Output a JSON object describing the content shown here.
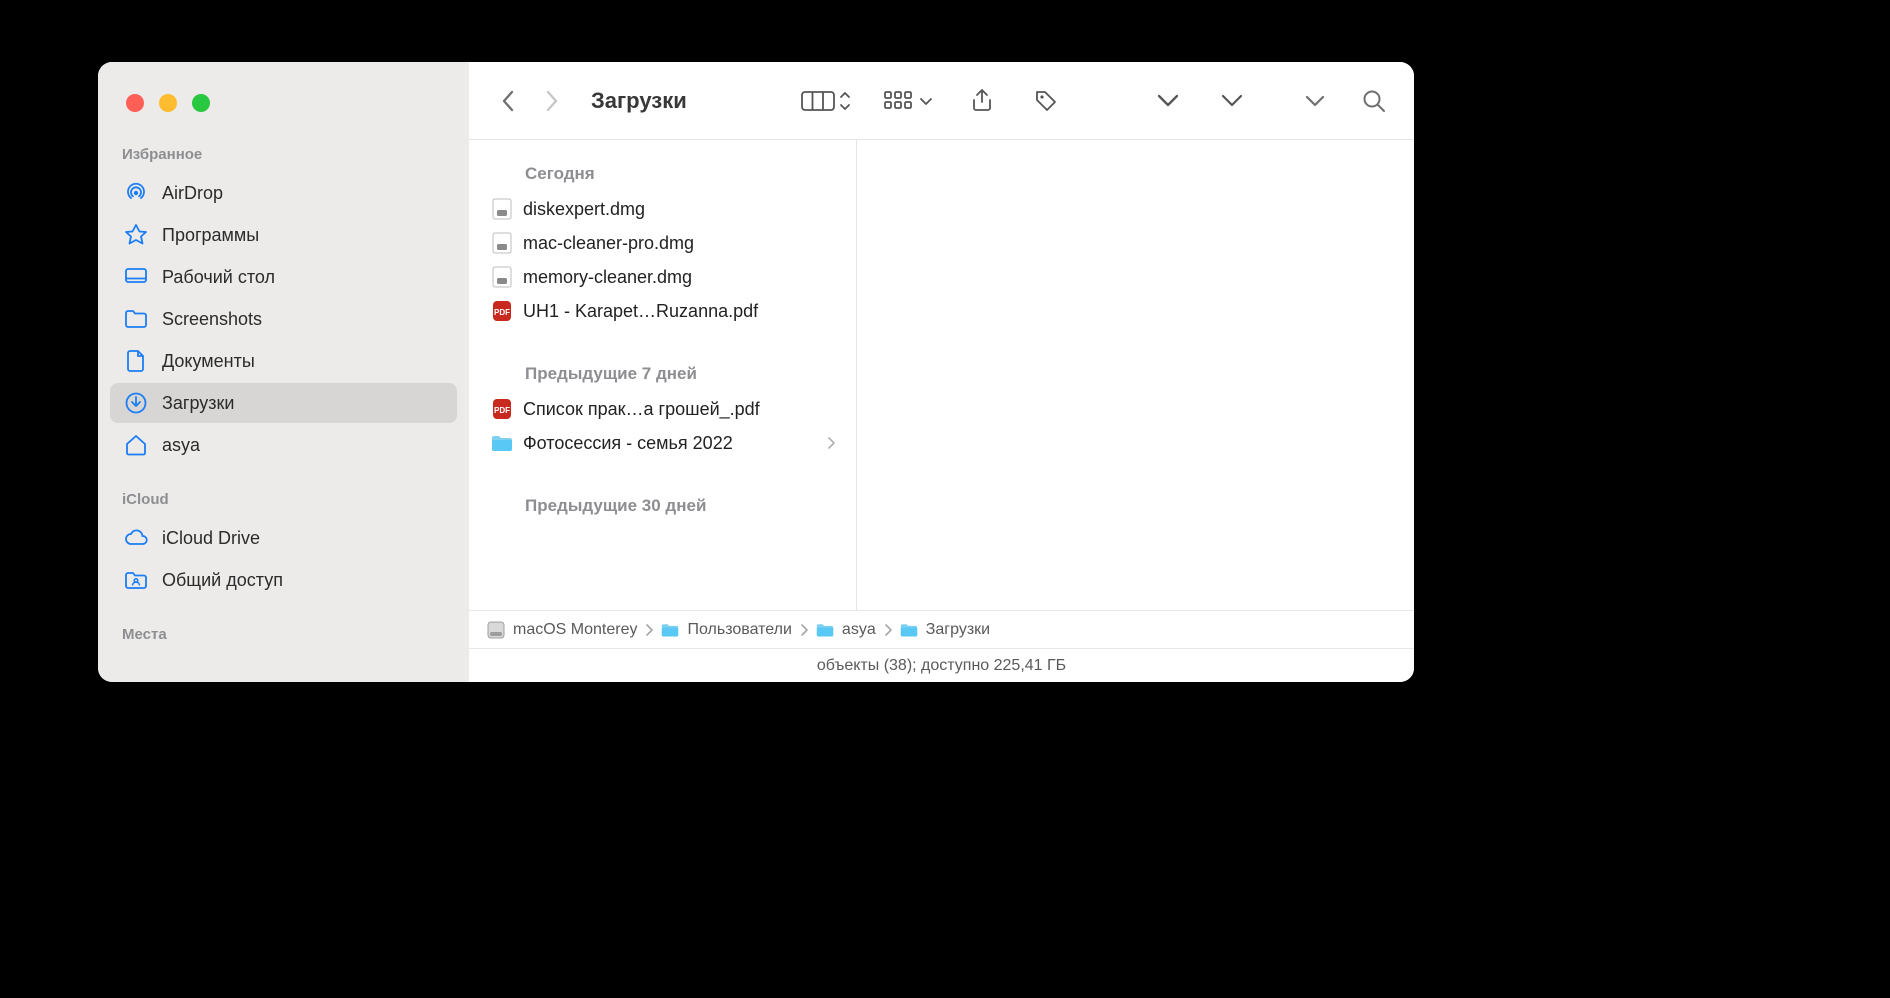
{
  "window_title": "Загрузки",
  "sidebar": {
    "sections": [
      {
        "label": "Избранное",
        "items": [
          {
            "icon": "airdrop",
            "label": "AirDrop",
            "selected": false
          },
          {
            "icon": "apps",
            "label": "Программы",
            "selected": false
          },
          {
            "icon": "desktop",
            "label": "Рабочий стол",
            "selected": false
          },
          {
            "icon": "folder",
            "label": "Screenshots",
            "selected": false
          },
          {
            "icon": "doc",
            "label": "Документы",
            "selected": false
          },
          {
            "icon": "downloads",
            "label": "Загрузки",
            "selected": true
          },
          {
            "icon": "home",
            "label": "asya",
            "selected": false
          }
        ]
      },
      {
        "label": "iCloud",
        "items": [
          {
            "icon": "cloud",
            "label": "iCloud Drive",
            "selected": false
          },
          {
            "icon": "shared",
            "label": "Общий доступ",
            "selected": false
          }
        ]
      },
      {
        "label": "Места",
        "items": []
      }
    ]
  },
  "content": {
    "groups": [
      {
        "label": "Сегодня",
        "items": [
          {
            "icon": "dmg",
            "name": "diskexpert.dmg",
            "has_children": false
          },
          {
            "icon": "dmg",
            "name": "mac-cleaner-pro.dmg",
            "has_children": false
          },
          {
            "icon": "dmg",
            "name": "memory-cleaner.dmg",
            "has_children": false
          },
          {
            "icon": "pdf",
            "name": "UH1 - Karapet…Ruzanna.pdf",
            "has_children": false
          }
        ]
      },
      {
        "label": "Предыдущие 7 дней",
        "items": [
          {
            "icon": "pdf",
            "name": "Список прак…а грошей_.pdf",
            "has_children": false
          },
          {
            "icon": "folder-lt",
            "name": "Фотосессия - семья 2022",
            "has_children": true
          }
        ]
      },
      {
        "label": "Предыдущие 30 дней",
        "items": []
      }
    ]
  },
  "pathbar": {
    "crumbs": [
      {
        "icon": "disk",
        "label": "macOS Monterey"
      },
      {
        "icon": "folder-lt",
        "label": "Пользователи"
      },
      {
        "icon": "folder-lt",
        "label": "asya"
      },
      {
        "icon": "folder-lt",
        "label": "Загрузки"
      }
    ]
  },
  "status": "объекты (38); доступно 225,41 ГБ"
}
